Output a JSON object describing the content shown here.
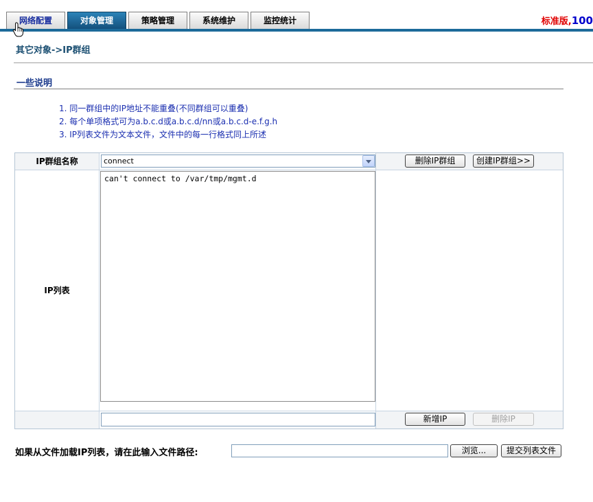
{
  "tabs": [
    {
      "label": "网络配置",
      "active": false
    },
    {
      "label": "对象管理",
      "active": true
    },
    {
      "label": "策略管理",
      "active": false
    },
    {
      "label": "系统维护",
      "active": false
    },
    {
      "label": "监控统计",
      "active": false
    }
  ],
  "edition": {
    "label": "标准版,",
    "number": "100"
  },
  "breadcrumb": "其它对象->IP群组",
  "notes": {
    "title": "一些说明",
    "items": [
      "1. 同一群组中的IP地址不能重叠(不同群组可以重叠)",
      "2. 每个单项格式可为a.b.c.d或a.b.c.d/nn或a.b.c.d-e.f.g.h",
      "3. IP列表文件为文本文件，文件中的每一行格式同上所述"
    ]
  },
  "group": {
    "label": "IP群组名称",
    "selected": "connect",
    "delete_button": "删除IP群组",
    "create_button": "创建IP群组>>"
  },
  "iplist": {
    "label": "IP列表",
    "content": "can't connect to /var/tmp/mgmt.d",
    "new_ip_value": "",
    "add_button": "新增IP",
    "delete_button": "删除IP"
  },
  "file_load": {
    "label": "如果从文件加载IP列表，请在此输入文件路径:",
    "path_value": "",
    "browse_button": "浏览...",
    "submit_button": "提交列表文件"
  },
  "colors": {
    "tab_active": "#1c6a9a",
    "bar_line": "#1c6a9a",
    "edition_text": "#e00000",
    "edition_number": "#0000cc",
    "notes_text": "#1b2fb0"
  },
  "icons": {
    "cursor": "hand-pointer-icon",
    "select_arrow": "chevron-down-icon"
  }
}
